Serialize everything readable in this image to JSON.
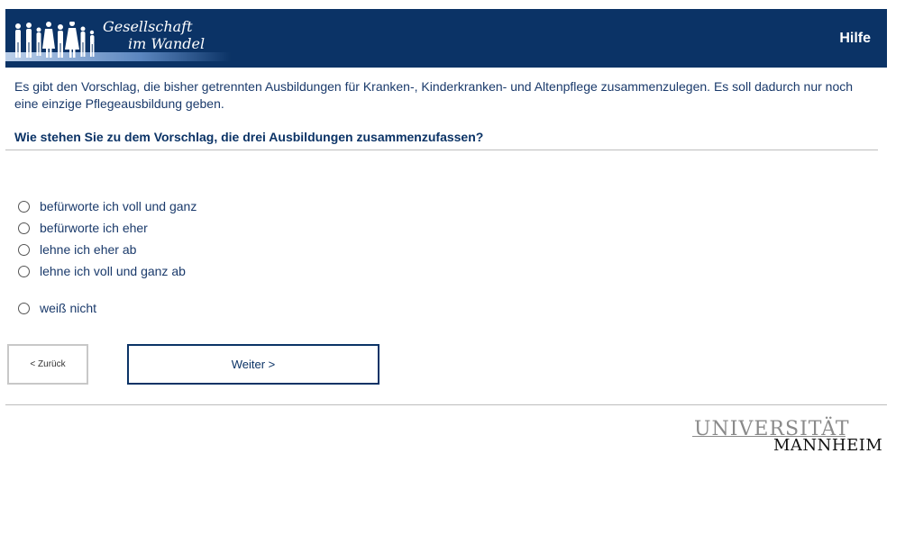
{
  "header": {
    "logo_line1": "Gesellschaft",
    "logo_line2": "im Wandel",
    "help_label": "Hilfe",
    "background_color": "#0b3366"
  },
  "intro_text": "Es gibt den Vorschlag, die bisher getrennten Ausbildungen für Kranken-, Kinderkranken- und Altenpflege zusammenzulegen. Es soll dadurch nur noch eine einzige Pflegeausbildung geben.",
  "question_text": "Wie stehen Sie zu dem Vorschlag, die drei Ausbildungen zusammenzufassen?",
  "options": [
    {
      "label": "befürworte ich voll und ganz",
      "selected": false
    },
    {
      "label": "befürworte ich eher",
      "selected": false
    },
    {
      "label": "lehne ich eher ab",
      "selected": false
    },
    {
      "label": "lehne ich voll und ganz ab",
      "selected": false
    },
    {
      "label": "weiß nicht",
      "selected": false
    }
  ],
  "nav": {
    "back_label": "< Zurück",
    "next_label": "Weiter >"
  },
  "footer_logo": {
    "line1": "UNIVERSITÄT",
    "line2": "MANNHEIM"
  }
}
